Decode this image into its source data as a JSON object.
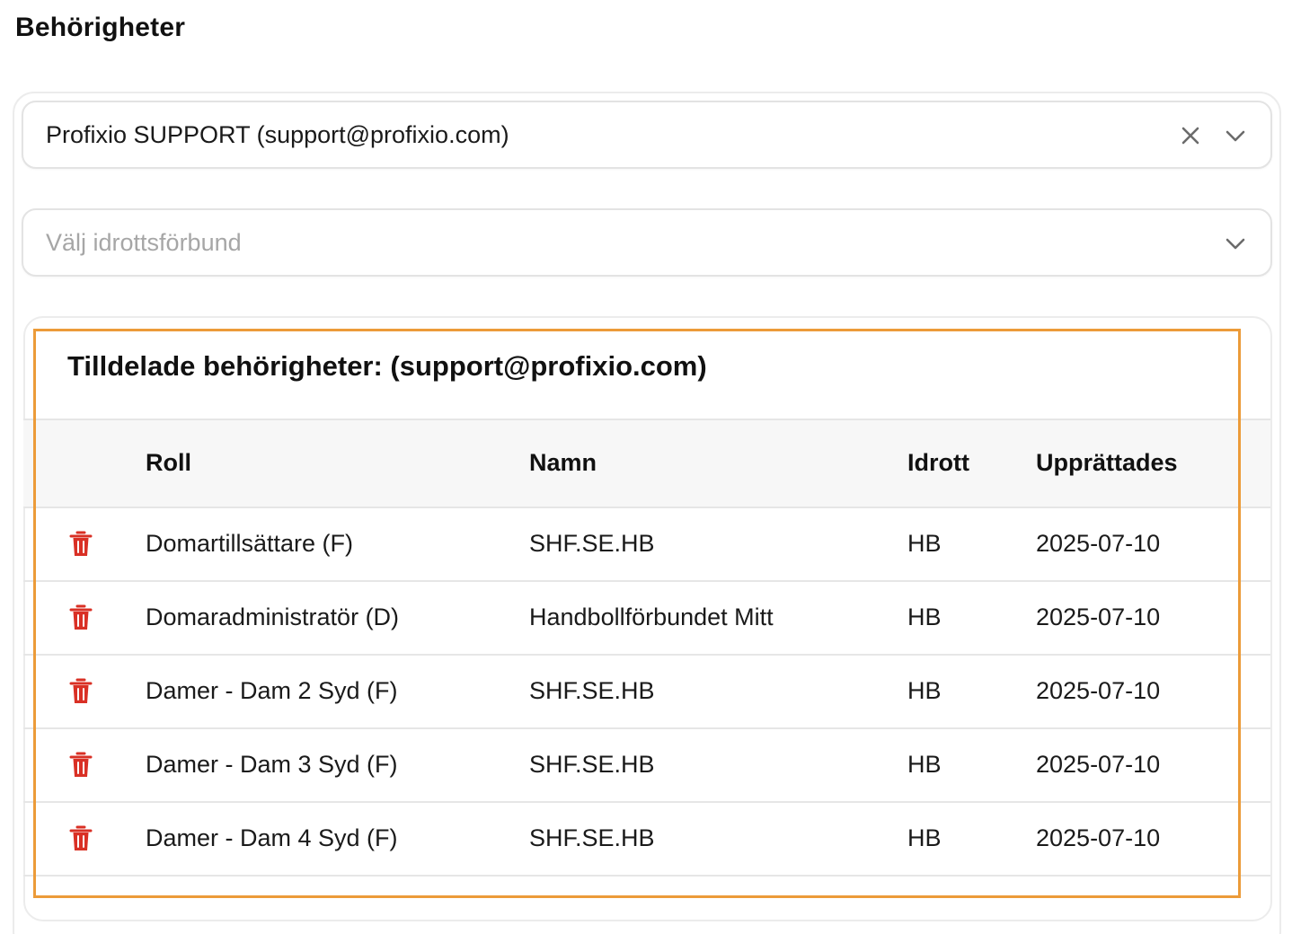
{
  "page": {
    "title": "Behörigheter"
  },
  "user_select": {
    "value": "Profixio SUPPORT (support@profixio.com)"
  },
  "federation_select": {
    "placeholder": "Välj idrottsförbund"
  },
  "assigned": {
    "title": "Tilldelade behörigheter: (support@profixio.com)",
    "columns": {
      "roll": "Roll",
      "namn": "Namn",
      "idrott": "Idrott",
      "date": "Upprättades"
    },
    "rows": [
      {
        "roll": "Domartillsättare (F)",
        "namn": "SHF.SE.HB",
        "idrott": "HB",
        "date": "2025-07-10"
      },
      {
        "roll": "Domaradministratör (D)",
        "namn": "Handbollförbundet Mitt",
        "idrott": "HB",
        "date": "2025-07-10"
      },
      {
        "roll": "Damer - Dam 2 Syd (F)",
        "namn": "SHF.SE.HB",
        "idrott": "HB",
        "date": "2025-07-10"
      },
      {
        "roll": "Damer - Dam 3 Syd (F)",
        "namn": "SHF.SE.HB",
        "idrott": "HB",
        "date": "2025-07-10"
      },
      {
        "roll": "Damer - Dam 4 Syd (F)",
        "namn": "SHF.SE.HB",
        "idrott": "HB",
        "date": "2025-07-10"
      }
    ]
  },
  "icons": {
    "delete": "trash-icon",
    "clear": "close-icon",
    "expand": "chevron-down-icon"
  },
  "colors": {
    "delete_icon": "#d93025",
    "highlight": "#ec9b39",
    "header_bg": "#f7f7f7"
  }
}
